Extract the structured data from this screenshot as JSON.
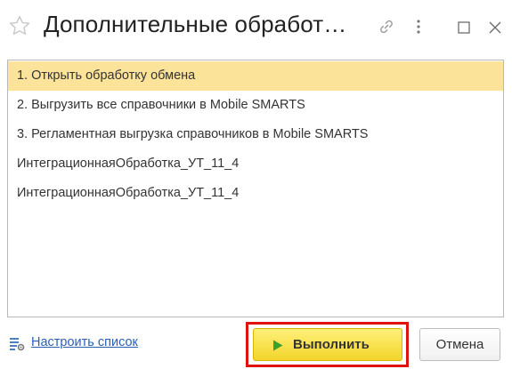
{
  "window": {
    "title": "Дополнительные обработ…"
  },
  "icons": {
    "favorite": "star-icon",
    "link": "link-icon",
    "more": "more-vertical-icon",
    "maximize": "maximize-icon",
    "close": "close-icon",
    "settings": "list-settings-icon",
    "execute": "play-icon"
  },
  "list": {
    "items": [
      {
        "label": "1. Открыть обработку обмена",
        "selected": true
      },
      {
        "label": "2. Выгрузить все справочники в Mobile SMARTS",
        "selected": false
      },
      {
        "label": "3. Регламентная выгрузка справочников в Mobile SMARTS",
        "selected": false
      },
      {
        "label": "ИнтеграционнаяОбработка_УТ_11_4",
        "selected": false
      },
      {
        "label": "ИнтеграционнаяОбработка_УТ_11_4",
        "selected": false
      }
    ]
  },
  "footer": {
    "settings_link": "Настроить список",
    "execute_label": "Выполнить",
    "cancel_label": "Отмена"
  },
  "colors": {
    "selected_row": "#fbe39a",
    "execute_button": "#f3d52a",
    "highlight_frame": "#e0120f",
    "link": "#2b5fb4",
    "play_icon": "#3aa12a"
  }
}
